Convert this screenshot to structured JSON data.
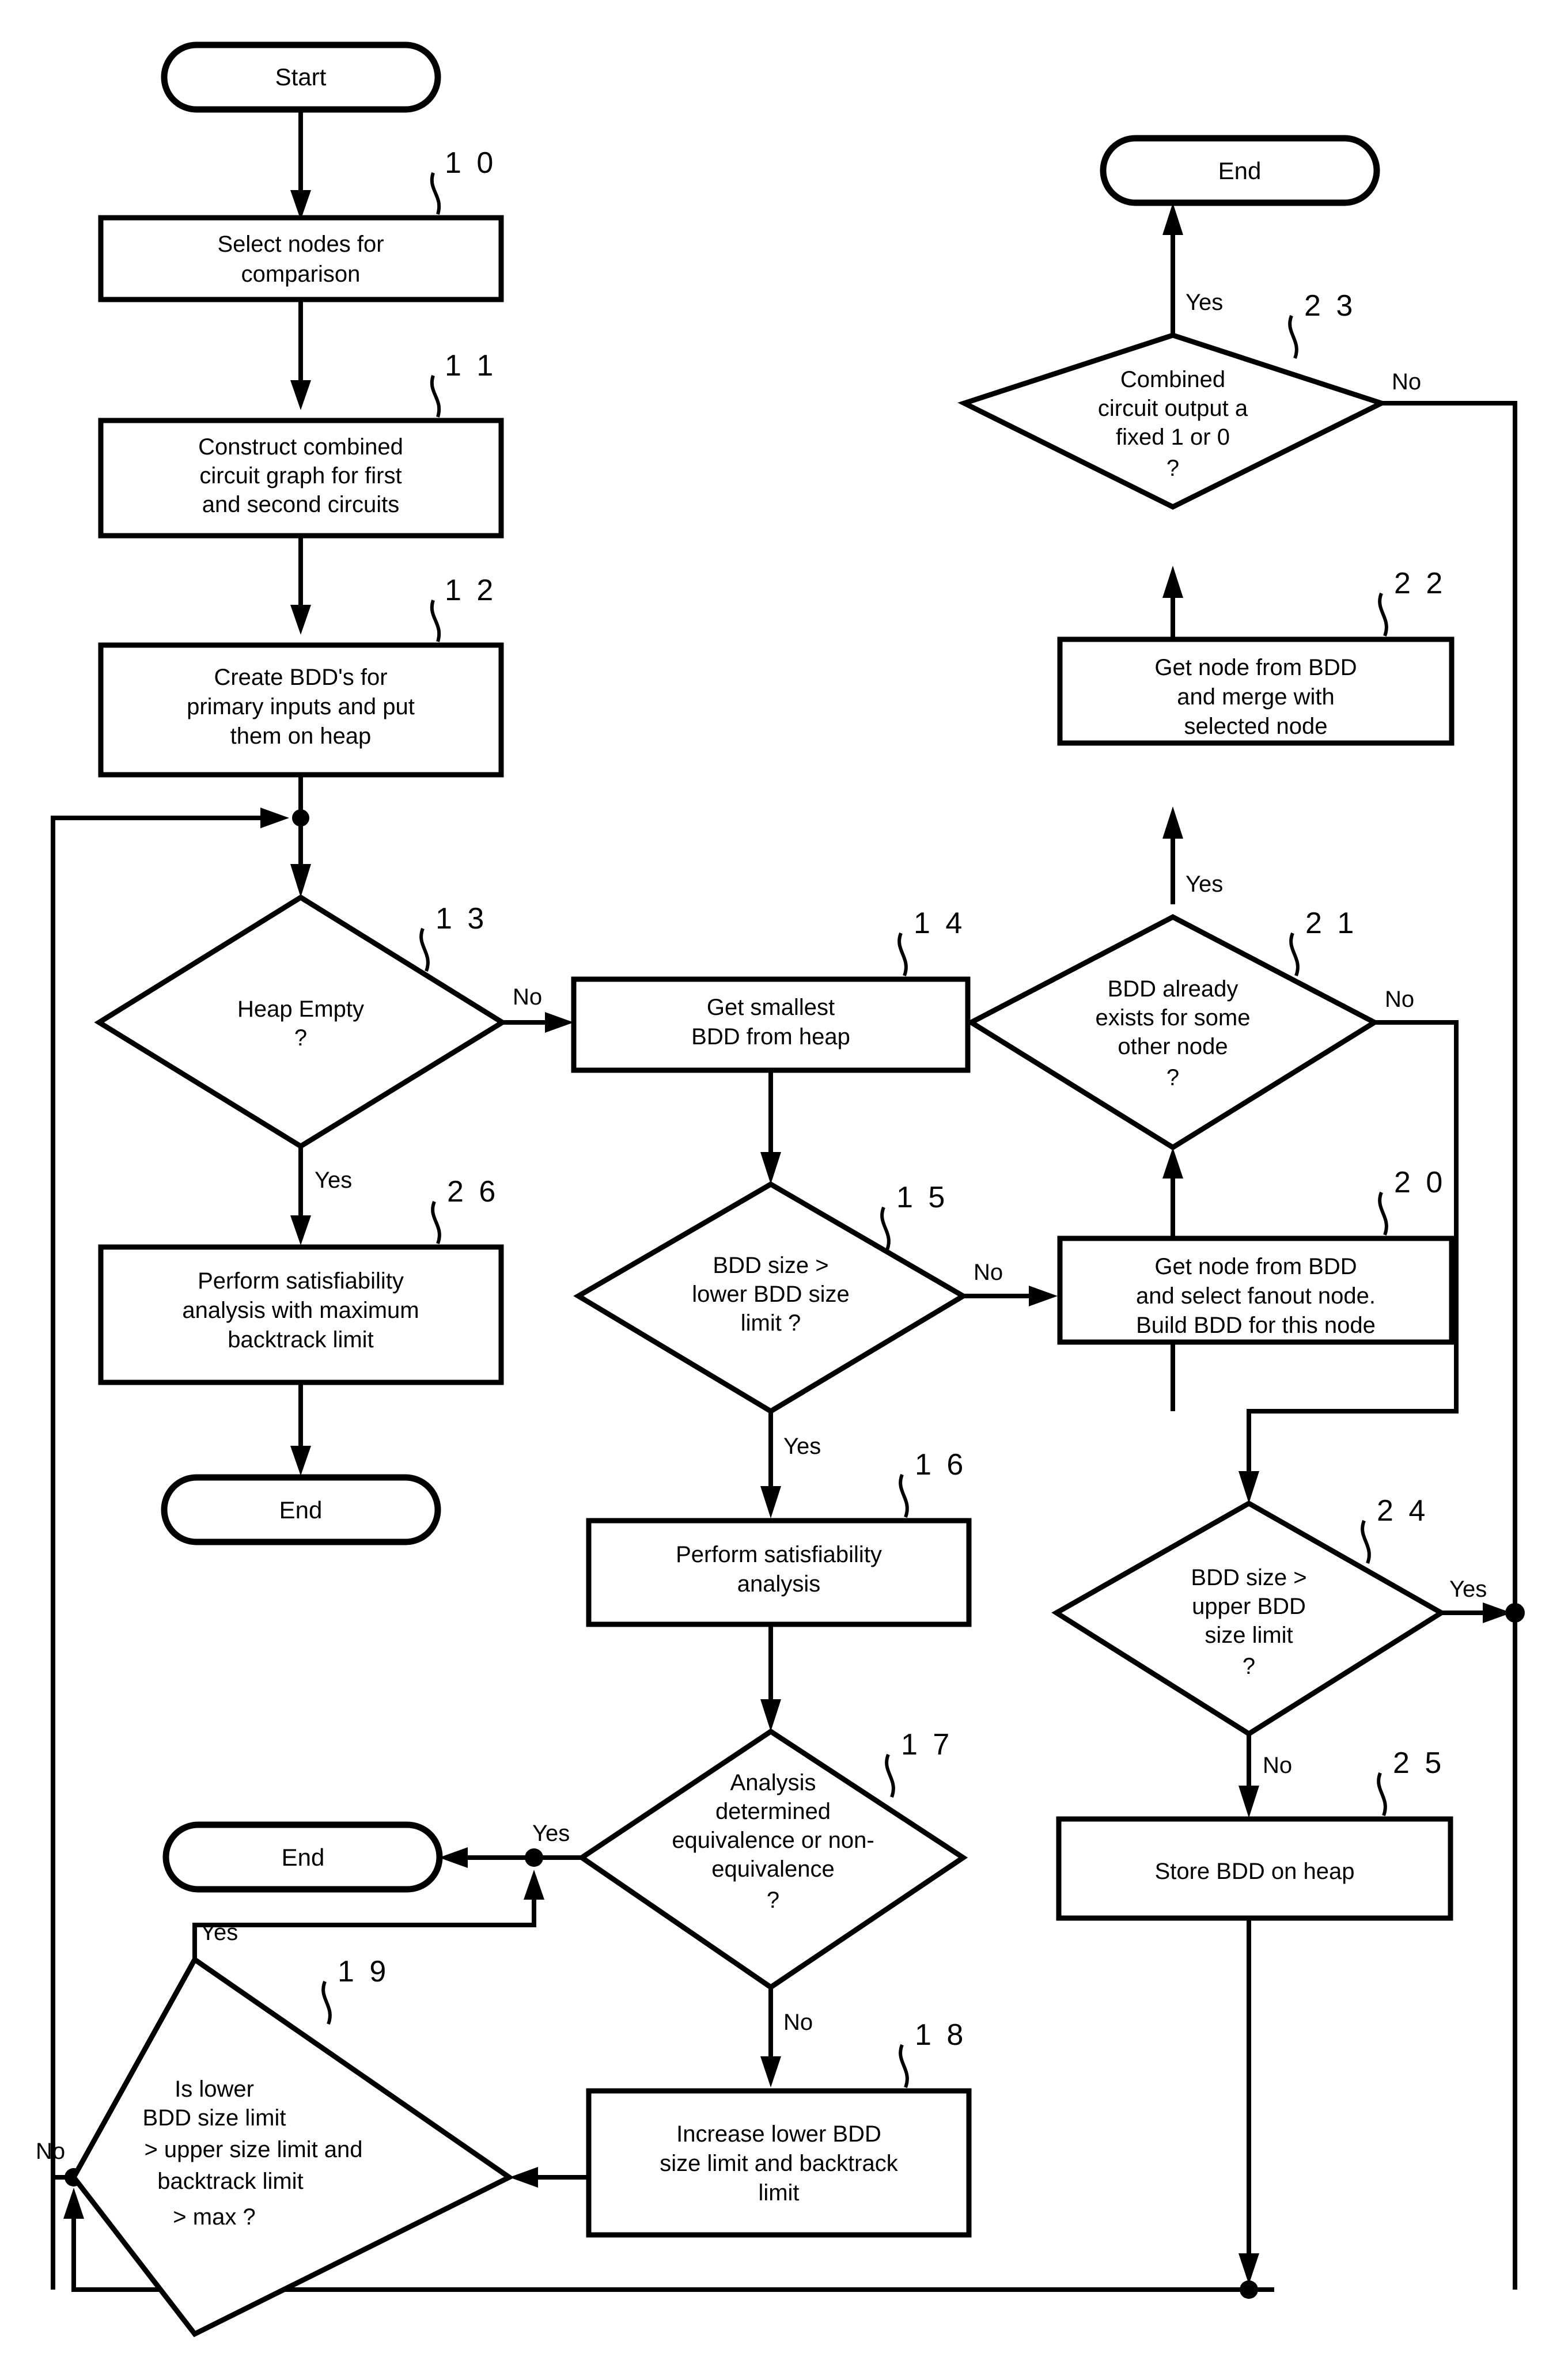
{
  "figure": {
    "kind": "process-flowchart",
    "title": "Binary decision diagram circuit equivalence checking flowchart"
  },
  "terminals": [
    {
      "id": "start",
      "label": "Start"
    },
    {
      "id": "end_right",
      "label": "End"
    },
    {
      "id": "end_left_26",
      "label": "End"
    },
    {
      "id": "end_left_17",
      "label": "End"
    }
  ],
  "nodes": [
    {
      "ref": "1 0",
      "shape": "process",
      "lines": [
        "Select nodes for",
        "comparison"
      ]
    },
    {
      "ref": "1 1",
      "shape": "process",
      "lines": [
        "Construct combined",
        "circuit graph for first",
        "and second circuits"
      ]
    },
    {
      "ref": "1 2",
      "shape": "process",
      "lines": [
        "Create BDD's for",
        "primary inputs and put",
        "them on heap"
      ]
    },
    {
      "ref": "1 3",
      "shape": "decision",
      "lines": [
        "Heap Empty",
        "?"
      ]
    },
    {
      "ref": "1 4",
      "shape": "process",
      "lines": [
        "Get smallest",
        "BDD from heap"
      ]
    },
    {
      "ref": "1 5",
      "shape": "decision",
      "lines": [
        "BDD size >",
        "lower BDD size",
        "limit ?"
      ]
    },
    {
      "ref": "1 6",
      "shape": "process",
      "lines": [
        "Perform satisfiability",
        "analysis"
      ]
    },
    {
      "ref": "1 7",
      "shape": "decision",
      "lines": [
        "Analysis",
        "determined",
        "equivalence or non-",
        "equivalence",
        "?"
      ]
    },
    {
      "ref": "1 8",
      "shape": "process",
      "lines": [
        "Increase lower BDD",
        "size limit and backtrack",
        "limit"
      ]
    },
    {
      "ref": "1 9",
      "shape": "decision",
      "lines": [
        "Is lower",
        "BDD size limit",
        "> upper size limit and",
        "backtrack limit",
        "> max ?"
      ]
    },
    {
      "ref": "2 0",
      "shape": "process",
      "lines": [
        "Get node from BDD",
        "and select fanout node.",
        "Build BDD for this node"
      ]
    },
    {
      "ref": "2 1",
      "shape": "decision",
      "lines": [
        "BDD already",
        "exists for some",
        "other node",
        "?"
      ]
    },
    {
      "ref": "2 2",
      "shape": "process",
      "lines": [
        "Get node from BDD",
        "and merge with",
        "selected node"
      ]
    },
    {
      "ref": "2 3",
      "shape": "decision",
      "lines": [
        "Combined",
        "circuit output a",
        "fixed 1 or 0",
        "?"
      ]
    },
    {
      "ref": "2 4",
      "shape": "decision",
      "lines": [
        "BDD size >",
        "upper BDD",
        "size limit",
        "?"
      ]
    },
    {
      "ref": "2 5",
      "shape": "process",
      "lines": [
        "Store BDD on heap"
      ]
    },
    {
      "ref": "2 6",
      "shape": "process",
      "lines": [
        "Perform satisfiability",
        "analysis with maximum",
        "backtrack limit"
      ]
    }
  ],
  "edge_labels": {
    "d13_no": "No",
    "d13_yes": "Yes",
    "d15_no": "No",
    "d15_yes": "Yes",
    "d17_yes": "Yes",
    "d17_no": "No",
    "d19_yes": "Yes",
    "d19_no": "No",
    "d21_yes": "Yes",
    "d21_no": "No",
    "d23_yes": "Yes",
    "d23_no": "No",
    "d24_yes": "Yes",
    "d24_no": "No"
  },
  "colors": {
    "stroke": "#000000",
    "fill": "#ffffff",
    "background": "#ffffff"
  }
}
